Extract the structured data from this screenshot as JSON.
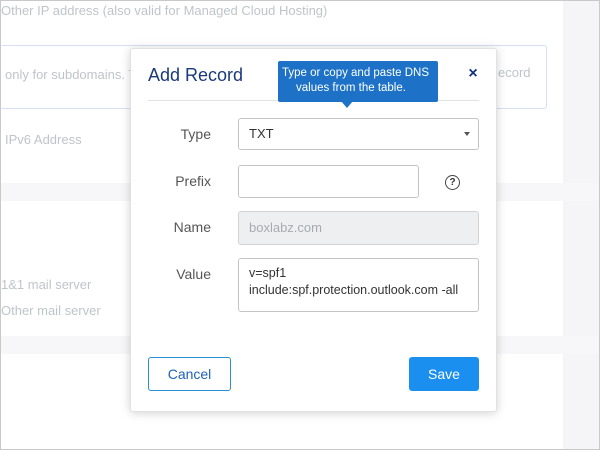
{
  "background": {
    "line_ip": "Other IP address (also valid for Managed Cloud Hosting)",
    "box_left_text": "only for subdomains. T",
    "box_right_text": "ecord",
    "ipv6": "IPv6 Address",
    "mail1": "1&1 mail server",
    "mail2": "Other mail server"
  },
  "dialog": {
    "title": "Add Record",
    "close_symbol": "×",
    "tooltip": {
      "line1": "Type or copy and paste DNS",
      "line2": "values from the table."
    },
    "fields": {
      "type": {
        "label": "Type",
        "value": "TXT"
      },
      "prefix": {
        "label": "Prefix",
        "value": ""
      },
      "help_symbol": "?",
      "name": {
        "label": "Name",
        "placeholder": "boxlabz.com"
      },
      "value": {
        "label": "Value",
        "line1": "v=spf1",
        "line2": "include:spf.protection.outlook.com -all"
      }
    },
    "buttons": {
      "cancel": "Cancel",
      "save": "Save"
    }
  },
  "colors": {
    "title": "#1a3a7a",
    "tooltip_bg": "#1d72c7",
    "primary": "#1a8ff0",
    "outline": "#2b8fd6"
  }
}
